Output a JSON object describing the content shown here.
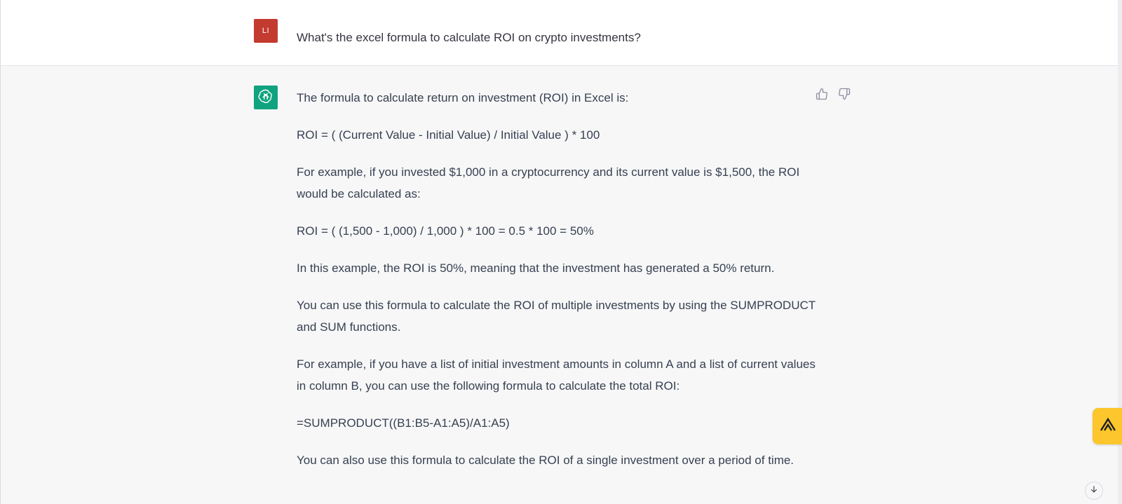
{
  "user_message": {
    "avatar_initials": "LI",
    "text": "What's the excel formula to calculate ROI on crypto investments?"
  },
  "assistant_message": {
    "paragraphs": [
      "The formula to calculate return on investment (ROI) in Excel is:",
      "ROI = ( (Current Value - Initial Value) / Initial Value ) * 100",
      "For example, if you invested $1,000 in a cryptocurrency and its current value is $1,500, the ROI would be calculated as:",
      "ROI = ( (1,500 - 1,000) / 1,000 ) * 100 = 0.5 * 100 = 50%",
      "In this example, the ROI is 50%, meaning that the investment has generated a 50% return.",
      "You can use this formula to calculate the ROI of multiple investments by using the SUMPRODUCT and SUM functions.",
      "For example, if you have a list of initial investment amounts in column A and a list of current values in column B, you can use the following formula to calculate the total ROI:",
      "=SUMPRODUCT((B1:B5-A1:A5)/A1:A5)",
      "You can also use this formula to calculate the ROI of a single investment over a period of time."
    ]
  },
  "icons": {
    "thumbs_up": "thumbs-up-icon",
    "thumbs_down": "thumbs-down-icon",
    "assistant_logo": "openai-logo-icon",
    "extension": "extension-icon",
    "scroll_down": "arrow-down-icon"
  },
  "colors": {
    "user_avatar": "#c33a2f",
    "assistant_avatar": "#10a37f",
    "extension_button": "#fcc62c"
  }
}
